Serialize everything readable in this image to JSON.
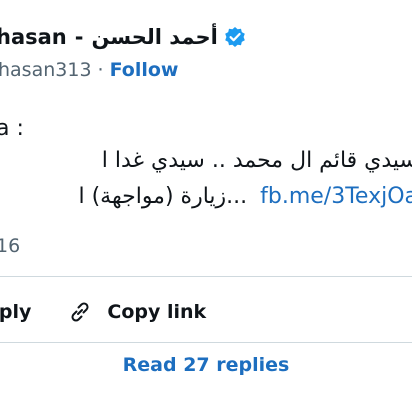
{
  "author": {
    "name_latin": "hasan",
    "name_separator": "-",
    "name_arabic": "أحمد الحسن",
    "handle": "hasan313",
    "follow_label": "Follow"
  },
  "tweet": {
    "line1": "a :",
    "line2": "سيدي قائم ال محمد .. سيدي غدا ا",
    "line3_link": "fb.me/3TexjOa",
    "line3_text": "زيارة (مواجهة) ا...",
    "time": "16"
  },
  "actions": {
    "reply_label": "eply",
    "copy_link_label": "Copy link",
    "read_replies_label": "Read 27 replies"
  },
  "colors": {
    "accent": "#1d6ebf",
    "muted": "#536471",
    "divider": "#cfd9de"
  }
}
